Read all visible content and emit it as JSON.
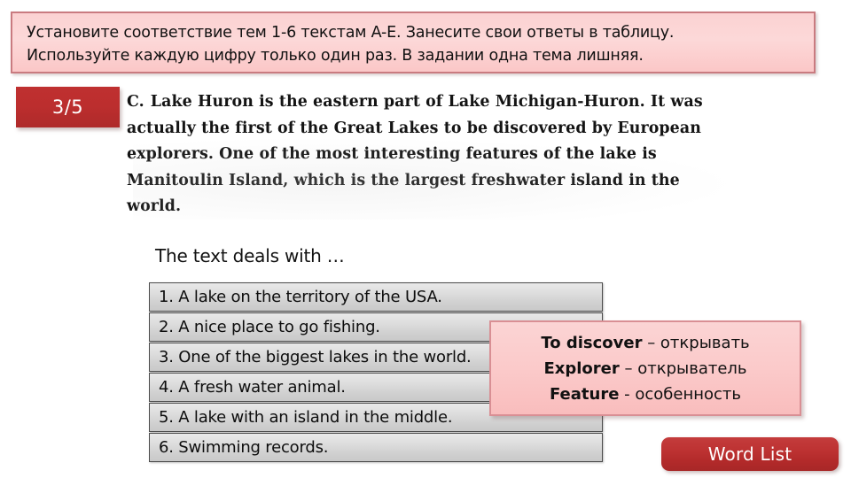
{
  "instruction": {
    "line1": "Установите соответствие тем 1-6 текстам A-E. Занесите свои ответы в таблицу.",
    "line2": "Используйте каждую цифру только один раз. В задании одна тема лишняя."
  },
  "slide_counter": {
    "value": "3/5"
  },
  "passage": {
    "label": "C.",
    "line1": "Lake Huron is the eastern part of Lake Michigan-Huron. It was",
    "line2": "actually the first of the Great Lakes to be discovered by European",
    "line3": "explorers. One of the most interesting features of the lake is",
    "line4": "Manitoulin Island, which is the largest freshwater island in the",
    "line5": "world."
  },
  "question": {
    "prompt": "The text deals with …"
  },
  "options": [
    {
      "label": "1. A lake on the territory of the USA."
    },
    {
      "label": "2. A nice place to go fishing."
    },
    {
      "label": "3. One of the biggest lakes in the world."
    },
    {
      "label": "4. A fresh water animal."
    },
    {
      "label": "5. A lake with an island in the middle."
    },
    {
      "label": "6. Swimming records."
    }
  ],
  "vocabulary": [
    {
      "en": "To discover",
      "sep": " – ",
      "ru": "открывать"
    },
    {
      "en": "Explorer",
      "sep": " – ",
      "ru": "открыватель"
    },
    {
      "en": "Feature",
      "sep": " - ",
      "ru": "особенность"
    }
  ],
  "word_list_button": {
    "label": "Word List"
  },
  "colors": {
    "banner_fill": "#fbd2d2",
    "banner_border": "#c97b80",
    "badge_red": "#bc2e2e",
    "callout_fill": "#fbcaca",
    "callout_border": "#d98f94",
    "button_red": "#bd3232",
    "option_fill": "#dcdcdc",
    "option_border": "#4c4c4c"
  }
}
